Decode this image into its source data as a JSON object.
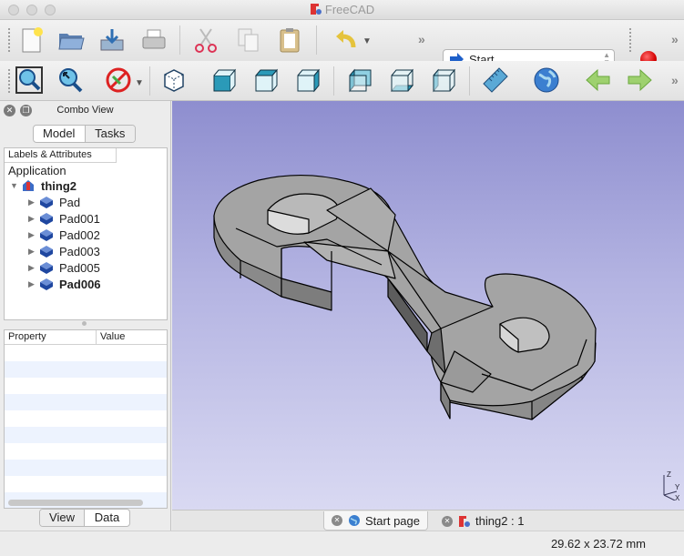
{
  "window": {
    "title": "FreeCAD"
  },
  "toolbar": {
    "workbench_selector": {
      "value": "Start"
    },
    "overflow_chevron": "»"
  },
  "combo_view": {
    "title": "Combo View",
    "tabs": [
      {
        "label": "Model",
        "active": true
      },
      {
        "label": "Tasks",
        "active": false
      }
    ],
    "tree": {
      "header": "Labels & Attributes",
      "root_label": "Application",
      "document": "thing2",
      "items": [
        {
          "label": "Pad",
          "bold": false
        },
        {
          "label": "Pad001",
          "bold": false
        },
        {
          "label": "Pad002",
          "bold": false
        },
        {
          "label": "Pad003",
          "bold": false
        },
        {
          "label": "Pad005",
          "bold": false
        },
        {
          "label": "Pad006",
          "bold": true
        }
      ]
    },
    "property_table": {
      "columns": [
        "Property",
        "Value"
      ]
    },
    "bottom_tabs": [
      {
        "label": "View",
        "active": false
      },
      {
        "label": "Data",
        "active": true
      }
    ]
  },
  "viewport": {
    "axis_labels": {
      "z": "Z",
      "y": "Y",
      "x": "X"
    }
  },
  "document_tabs": [
    {
      "label": "Start page",
      "active": true
    },
    {
      "label": "thing2 : 1",
      "active": false
    }
  ],
  "status_bar": {
    "dimensions": "29.62 x 23.72 mm"
  },
  "colors": {
    "viewport_top": "#8e8ecf",
    "viewport_bottom": "#d9d9f2",
    "record_button": "#d40000",
    "part_gray": "#9d9d9d"
  }
}
